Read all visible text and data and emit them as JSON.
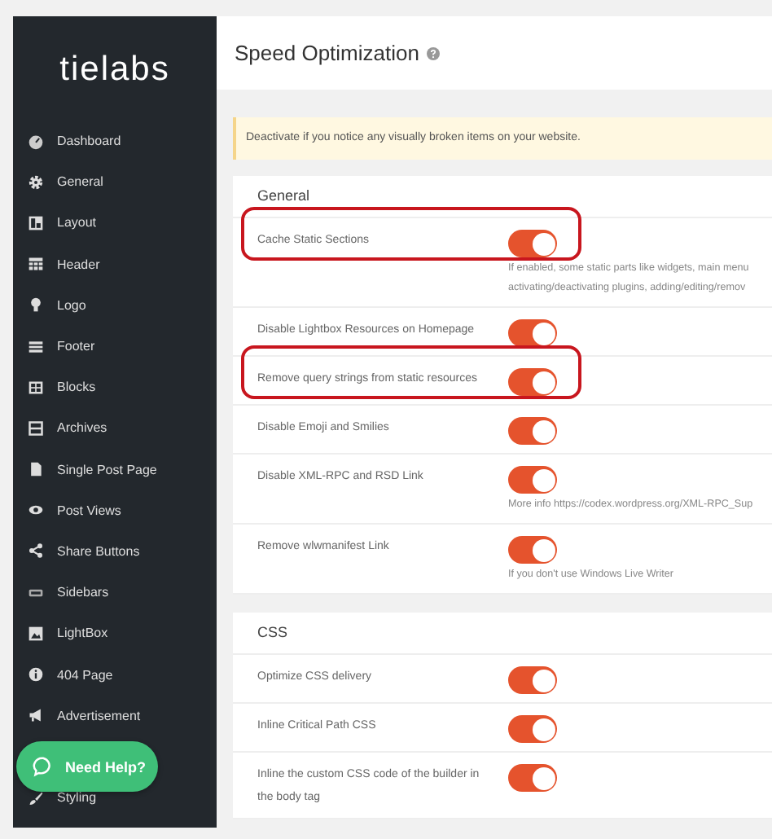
{
  "logo": "tielabs",
  "sidebar": {
    "items": [
      {
        "label": "Dashboard"
      },
      {
        "label": "General"
      },
      {
        "label": "Layout"
      },
      {
        "label": "Header"
      },
      {
        "label": "Logo"
      },
      {
        "label": "Footer"
      },
      {
        "label": "Blocks"
      },
      {
        "label": "Archives"
      },
      {
        "label": "Single Post Page"
      },
      {
        "label": "Post Views"
      },
      {
        "label": "Share Buttons"
      },
      {
        "label": "Sidebars"
      },
      {
        "label": "LightBox"
      },
      {
        "label": "404 Page"
      },
      {
        "label": "Advertisement"
      },
      {
        "label": "Styling"
      }
    ]
  },
  "help_button": {
    "label": "Need Help?"
  },
  "page": {
    "title": "Speed Optimization"
  },
  "notice": "Deactivate if you notice any visually broken items on your website.",
  "sections": [
    {
      "title": "General",
      "rows": [
        {
          "label": "Cache Static Sections",
          "on": true,
          "highlighted": true,
          "description": [
            "If enabled, some static parts like widgets, main menu",
            "activating/deactivating plugins, adding/editing/remov"
          ]
        },
        {
          "label": "Disable Lightbox Resources on Homepage",
          "on": true,
          "highlighted": false
        },
        {
          "label": "Remove query strings from static resources",
          "on": true,
          "highlighted": true
        },
        {
          "label": "Disable Emoji and Smilies",
          "on": true,
          "highlighted": false
        },
        {
          "label": "Disable XML-RPC and RSD Link",
          "on": true,
          "highlighted": false,
          "description": [
            "More info https://codex.wordpress.org/XML-RPC_Sup"
          ]
        },
        {
          "label": "Remove wlwmanifest Link",
          "on": true,
          "highlighted": false,
          "description": [
            "If you don't use Windows Live Writer"
          ]
        }
      ]
    },
    {
      "title": "CSS",
      "rows": [
        {
          "label": "Optimize CSS delivery",
          "on": true,
          "highlighted": false
        },
        {
          "label": "Inline Critical Path CSS",
          "on": true,
          "highlighted": false
        },
        {
          "label": "Inline the custom CSS code of the builder in the body tag",
          "on": true,
          "highlighted": false
        }
      ]
    }
  ]
}
